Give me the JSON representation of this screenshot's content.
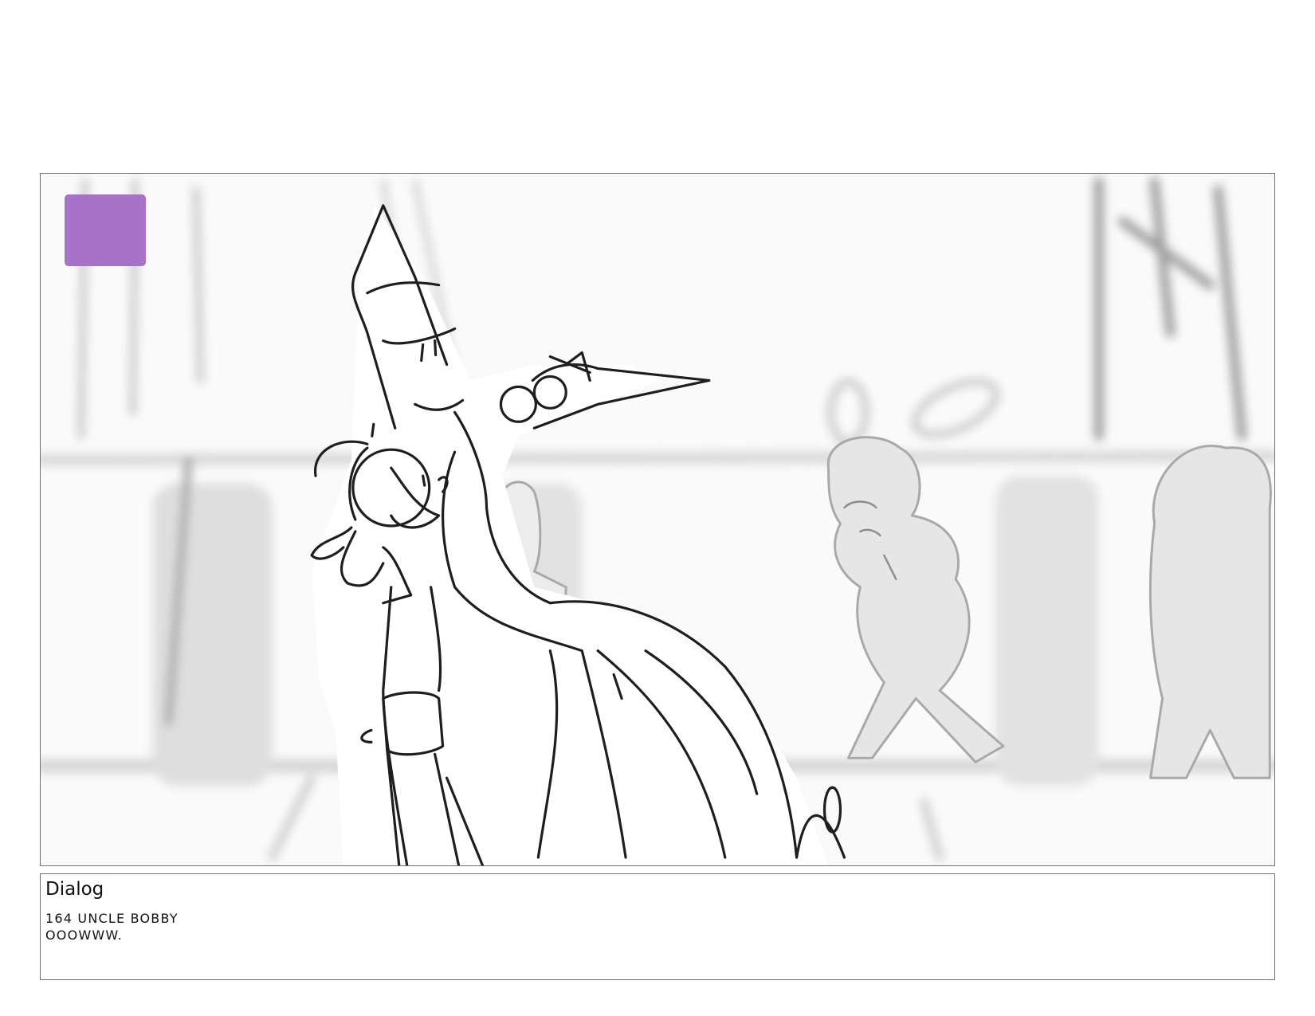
{
  "panel": {
    "marker_color": "#a673c9",
    "image_description_icon": "storyboard-sketch"
  },
  "dialog": {
    "title": "Dialog",
    "line1": "164 UNCLE BOBBY",
    "line2": "OOOWWW."
  }
}
